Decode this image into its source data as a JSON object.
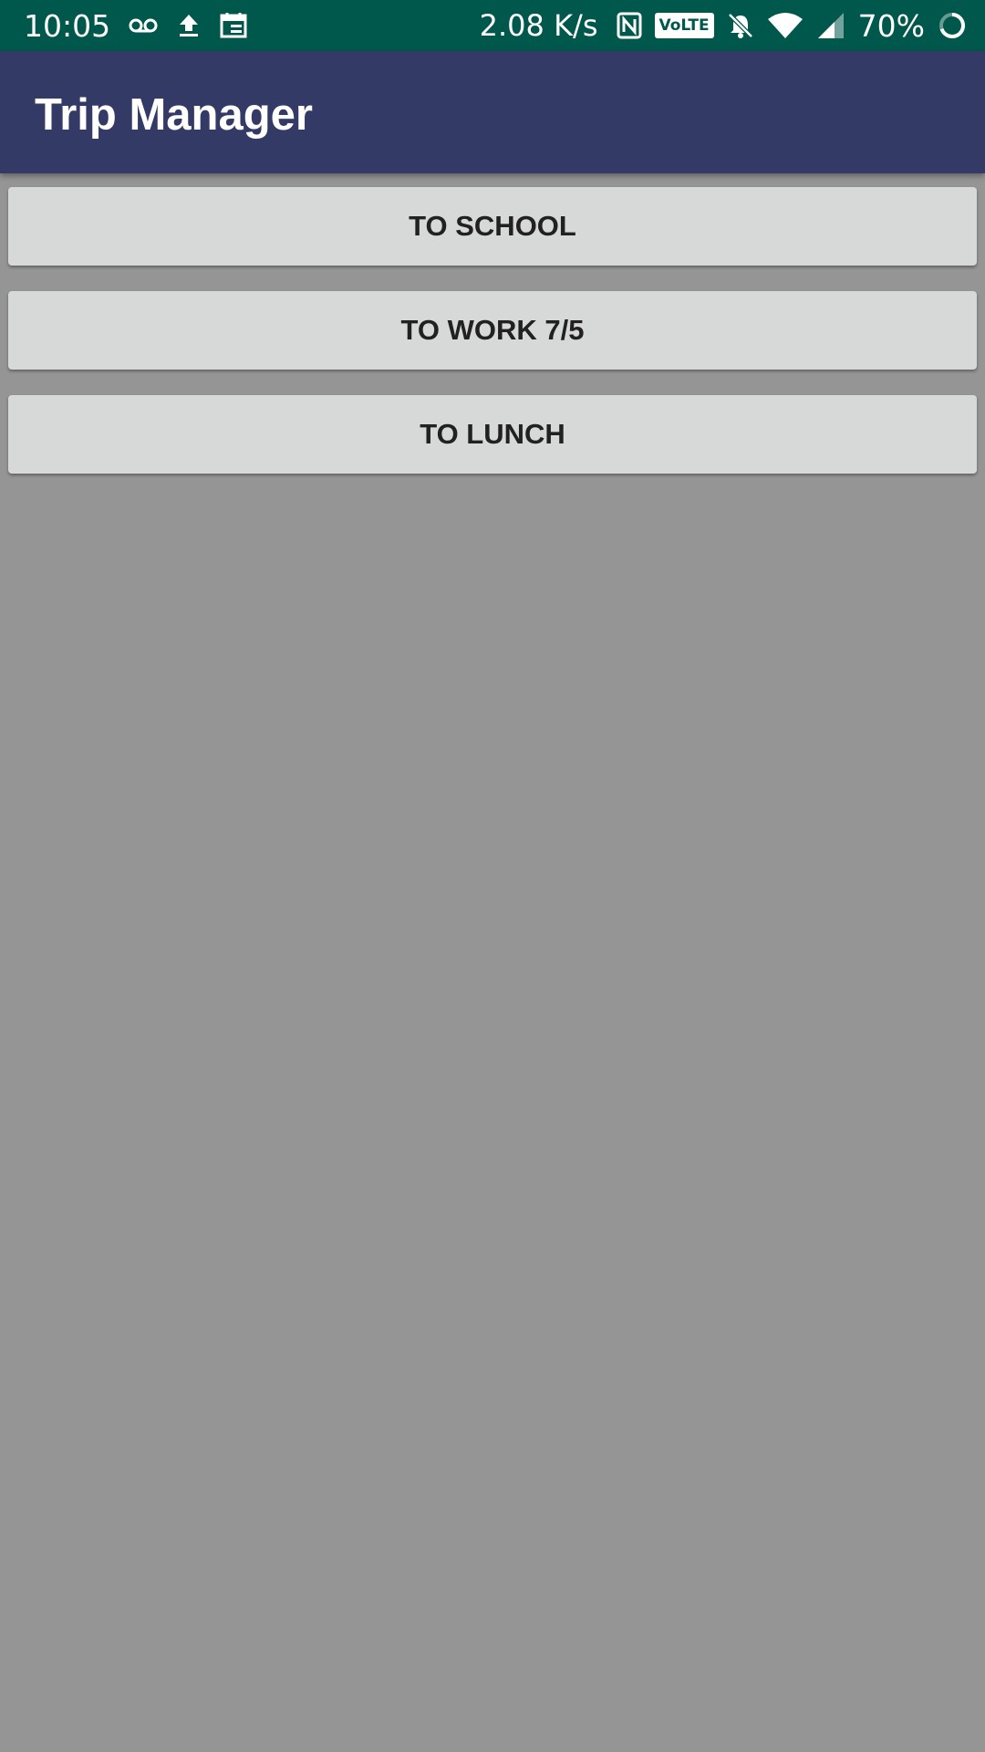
{
  "status_bar": {
    "time": "10:05",
    "speed": "2.08 K/s",
    "volte": "VoLTE",
    "battery": "70%",
    "icons": [
      "voicemail-icon",
      "upload-icon",
      "calendar-icon",
      "nfc-icon",
      "volte-icon",
      "bell-off-icon",
      "wifi-icon",
      "signal-icon",
      "battery-charging-icon"
    ],
    "background": "#00574b"
  },
  "app_bar": {
    "title": "Trip Manager",
    "background": "#343a66"
  },
  "trips": [
    {
      "label": "TO SCHOOL"
    },
    {
      "label": "TO WORK 7/5"
    },
    {
      "label": "TO LUNCH"
    }
  ],
  "colors": {
    "page_background": "#959595",
    "button_background": "#d7d8d8",
    "button_text": "#212121"
  }
}
